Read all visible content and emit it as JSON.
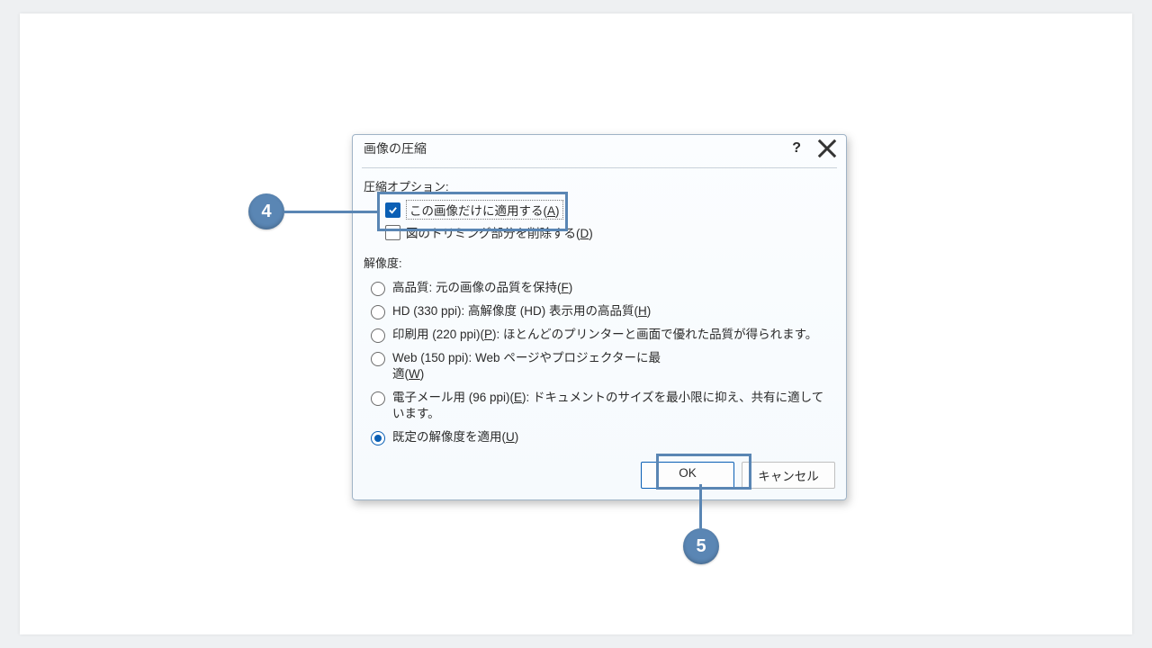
{
  "dialog": {
    "title": "画像の圧縮",
    "help_tooltip": "?",
    "close_tooltip": "×",
    "section_compress": "圧縮オプション:",
    "chk_apply_only": {
      "pre": "この画像だけに適用する(",
      "accel": "A",
      "post": ")"
    },
    "chk_delete_crop": {
      "pre": "図のトリミング部分を削除する(",
      "accel": "D",
      "post": ")"
    },
    "section_resolution": "解像度:",
    "radios": {
      "hq": {
        "pre": "高品質: 元の画像の品質を保持(",
        "accel": "F",
        "post": ")"
      },
      "hd": {
        "pre": "HD (330 ppi): 高解像度 (HD) 表示用の高品質(",
        "accel": "H",
        "post": ")"
      },
      "print": {
        "pre": "印刷用 (220 ppi)(",
        "accel": "P",
        "post": "): ほとんどのプリンターと画面で優れた品質が得られます。"
      },
      "web": {
        "pre": "Web (150 ppi): Web ページやプロジェクターに最適(",
        "accel": "W",
        "post": ")"
      },
      "email": {
        "pre": "電子メール用 (96 ppi)(",
        "accel": "E",
        "post": "): ドキュメントのサイズを最小限に抑え、共有に適しています。"
      },
      "def": {
        "pre": "既定の解像度を適用(",
        "accel": "U",
        "post": ")"
      }
    },
    "ok_label": "OK",
    "cancel_label": "キャンセル"
  },
  "callouts": {
    "four": "4",
    "five": "5"
  }
}
